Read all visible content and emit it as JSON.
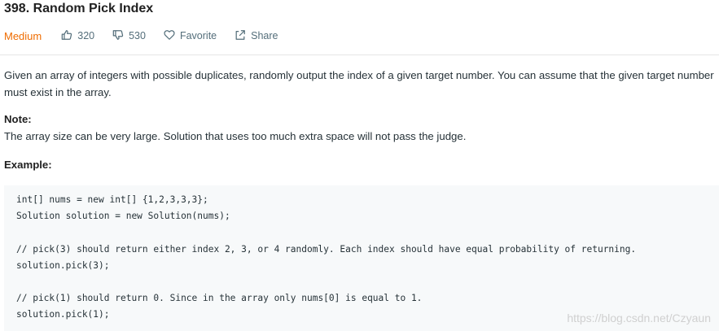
{
  "problem": {
    "title": "398. Random Pick Index",
    "difficulty": "Medium",
    "likes": "320",
    "dislikes": "530",
    "favorite_label": "Favorite",
    "share_label": "Share",
    "description": "Given an array of integers with possible duplicates, randomly output the index of a given target number. You can assume that the given target number must exist in the array.",
    "note_heading": "Note:",
    "note_text": "The array size can be very large. Solution that uses too much extra space will not pass the judge.",
    "example_heading": "Example:",
    "code_lines": [
      "int[] nums = new int[] {1,2,3,3,3};",
      "Solution solution = new Solution(nums);",
      "// pick(3) should return either index 2, 3, or 4 randomly. Each index should have equal probability of returning.",
      "solution.pick(3);",
      "// pick(1) should return 0. Since in the array only nums[0] is equal to 1.",
      "solution.pick(1);"
    ]
  },
  "watermark": "https://blog.csdn.net/Czyaun",
  "icons": {
    "like": "thumbs-up-icon",
    "dislike": "thumbs-down-icon",
    "favorite": "heart-icon",
    "share": "share-icon"
  }
}
